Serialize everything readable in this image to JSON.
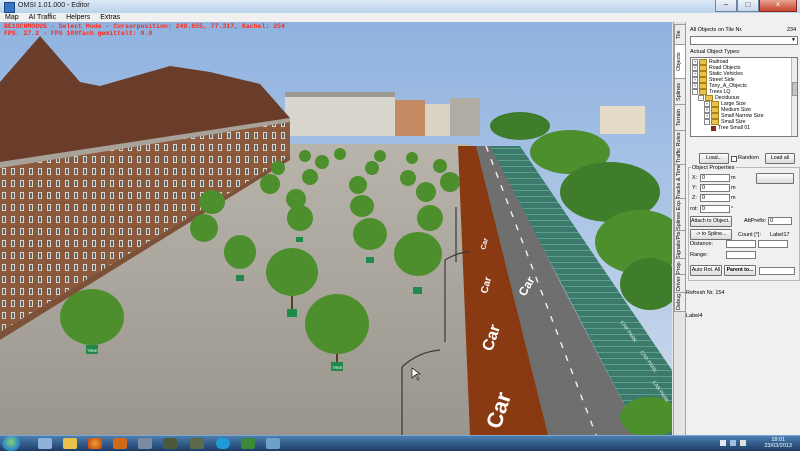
{
  "window": {
    "title": "OMSI 1.01.000 - Editor",
    "buttons": {
      "minimize": "–",
      "maximize": "□",
      "close": "×"
    }
  },
  "menu": [
    "Map",
    "AI Traffic",
    "Helpers",
    "Extras"
  ],
  "hud": {
    "line1": "BE1SCHMODUS - Select Mode - Cursorposition: 249.655, 77.317, Kachel: 254",
    "line2": "FPS: 27.2 - FPS 100fach gemittelt: 0.0"
  },
  "scene": {
    "tree_sign": "TREE",
    "road_markings": [
      "Car",
      "Car",
      "Car",
      "Car",
      "Car"
    ],
    "parking_label": "CAR PARK",
    "colors": {
      "sky": "#a9c4e8",
      "road": "#6f6f6f",
      "lane": "#8a3a12",
      "hedge": "#3c7a6c",
      "foliage": "#4d8f2c",
      "building": "#8b5a3c",
      "roof": "#6a3c2a"
    }
  },
  "panel": {
    "tabs": [
      "Tile",
      "Objects",
      "Splines",
      "Terrain",
      "Traffic Rules",
      "Tracks & Timet.",
      "Splines Exp.",
      "Signals/Pts",
      "Prop.",
      "Driver",
      "Debug"
    ],
    "objects_on_tile_label": "All Objects on Tile Nr.",
    "tile_number": "234",
    "actual_types_label": "Actual Object Types:",
    "tree": [
      {
        "label": "Railroad",
        "level": 0,
        "exp": "+"
      },
      {
        "label": "Road Objects",
        "level": 0,
        "exp": "+"
      },
      {
        "label": "Static Vehicles",
        "level": 0,
        "exp": "+"
      },
      {
        "label": "Street Side",
        "level": 0,
        "exp": "+"
      },
      {
        "label": "Tony_A_Objects",
        "level": 0,
        "exp": "+"
      },
      {
        "label": "Trees LQ",
        "level": 0,
        "exp": "-"
      },
      {
        "label": "Deciduous",
        "level": 1,
        "exp": "-"
      },
      {
        "label": "Large Size",
        "level": 2,
        "exp": "+"
      },
      {
        "label": "Medium Size",
        "level": 2,
        "exp": "+"
      },
      {
        "label": "Small Narrow Size",
        "level": 2,
        "exp": "+"
      },
      {
        "label": "Small Size",
        "level": 2,
        "exp": "-"
      },
      {
        "label": "Tree Small 01",
        "level": 3,
        "exp": ""
      }
    ],
    "load_label": "Load...",
    "random_label": "Random",
    "load_all_label": "Load all",
    "props_label": "Object Properties",
    "prop_fields": [
      {
        "label": "X:",
        "value": "0",
        "unit": "m"
      },
      {
        "label": "Y:",
        "value": "0",
        "unit": "m"
      },
      {
        "label": "Z:",
        "value": "0",
        "unit": "m"
      },
      {
        "label": "rot:",
        "value": "0",
        "unit": "°"
      }
    ],
    "attach_object_label": "Attach to Object...",
    "attprefix_label": "AttPrefix:",
    "attprefix_value": "0",
    "to_spline_label": "-> to Spline...",
    "count_label": "Count [°]:",
    "label7": "Label17",
    "distance_label": "Distance:",
    "range_label": "Range:",
    "auto_rot_label": "Auto Rot. All",
    "parent_label": "Parent to...",
    "refresh_label": "Refresh Nr. 154",
    "label4": "Label4"
  },
  "taskbar": {
    "time": "18:01",
    "date": "23/03/2013"
  }
}
